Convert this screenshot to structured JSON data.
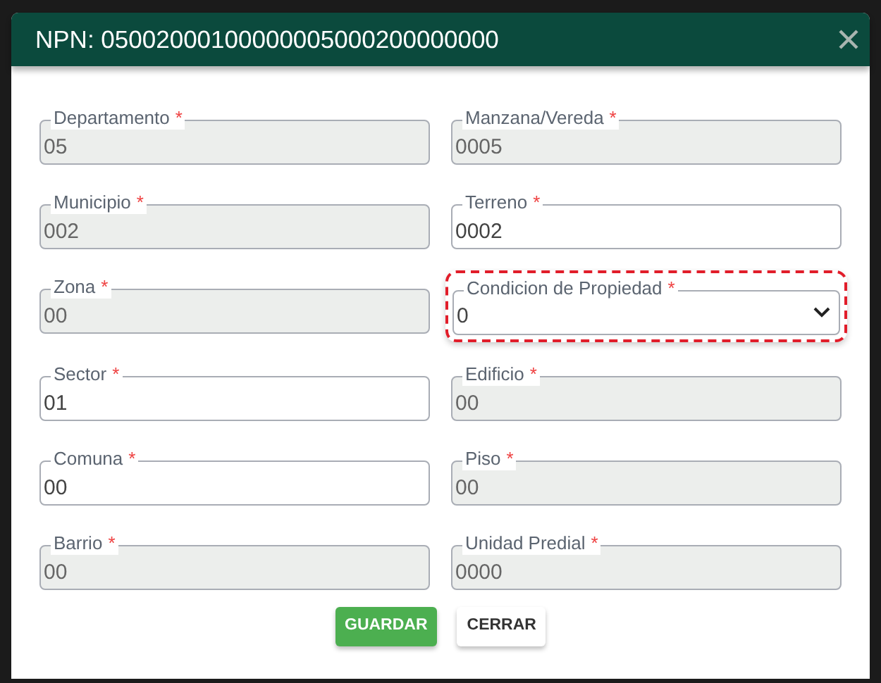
{
  "dialog": {
    "title": "NPN: 05002000100000005000200000000"
  },
  "fields": [
    {
      "label": "Departamento",
      "required_mark": "*",
      "value": "05",
      "kind": "text",
      "disabled": true,
      "highlighted": false
    },
    {
      "label": "Manzana/Vereda",
      "required_mark": "*",
      "value": "0005",
      "kind": "text",
      "disabled": true,
      "highlighted": false
    },
    {
      "label": "Municipio",
      "required_mark": "*",
      "value": "002",
      "kind": "text",
      "disabled": true,
      "highlighted": false
    },
    {
      "label": "Terreno",
      "required_mark": "*",
      "value": "0002",
      "kind": "text",
      "disabled": false,
      "highlighted": false
    },
    {
      "label": "Zona",
      "required_mark": "*",
      "value": "00",
      "kind": "text",
      "disabled": true,
      "highlighted": false
    },
    {
      "label": "Condicion de Propiedad",
      "required_mark": "*",
      "value": "0",
      "kind": "select",
      "disabled": false,
      "highlighted": true
    },
    {
      "label": "Sector",
      "required_mark": "*",
      "value": "01",
      "kind": "text",
      "disabled": false,
      "highlighted": false
    },
    {
      "label": "Edificio",
      "required_mark": "*",
      "value": "00",
      "kind": "text",
      "disabled": true,
      "highlighted": false
    },
    {
      "label": "Comuna",
      "required_mark": "*",
      "value": "00",
      "kind": "text",
      "disabled": false,
      "highlighted": false
    },
    {
      "label": "Piso",
      "required_mark": "*",
      "value": "00",
      "kind": "text",
      "disabled": true,
      "highlighted": false
    },
    {
      "label": "Barrio",
      "required_mark": "*",
      "value": "00",
      "kind": "text",
      "disabled": true,
      "highlighted": false
    },
    {
      "label": "Unidad Predial",
      "required_mark": "*",
      "value": "0000",
      "kind": "text",
      "disabled": true,
      "highlighted": false
    }
  ],
  "buttons": [
    {
      "label": "GUARDAR",
      "kind": "primary"
    },
    {
      "label": "CERRAR",
      "kind": "secondary"
    }
  ]
}
